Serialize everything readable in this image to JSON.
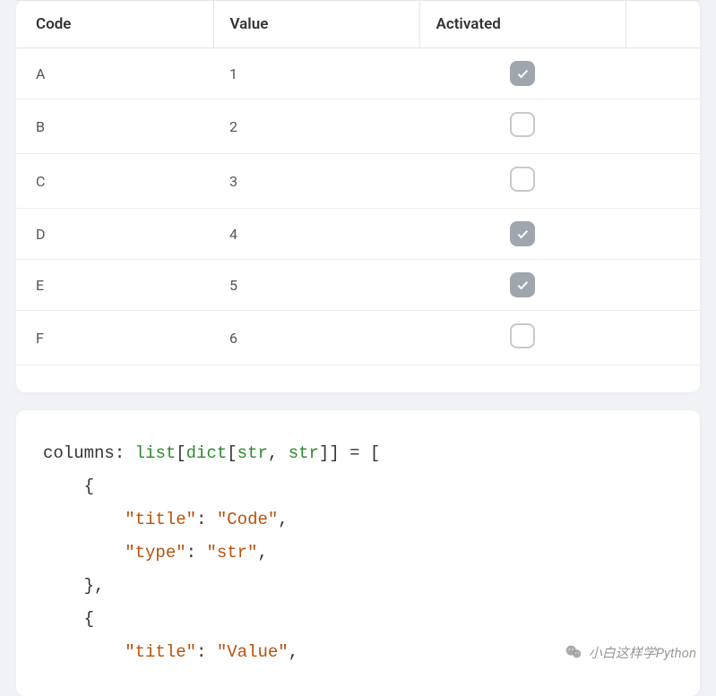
{
  "table": {
    "headers": {
      "code": "Code",
      "value": "Value",
      "activated": "Activated"
    },
    "rows": [
      {
        "code": "A",
        "value": "1",
        "activated": true
      },
      {
        "code": "B",
        "value": "2",
        "activated": false
      },
      {
        "code": "C",
        "value": "3",
        "activated": false
      },
      {
        "code": "D",
        "value": "4",
        "activated": true
      },
      {
        "code": "E",
        "value": "5",
        "activated": true
      },
      {
        "code": "F",
        "value": "6",
        "activated": false
      }
    ]
  },
  "code": {
    "line1_id": "columns",
    "line1_colon": ": ",
    "line1_list": "list",
    "line1_b1": "[",
    "line1_dict": "dict",
    "line1_b2": "[",
    "line1_str1": "str",
    "line1_comma": ", ",
    "line1_str2": "str",
    "line1_b3": "]] = [",
    "line2_brace": "{",
    "line3_key": "\"title\"",
    "line3_colon": ": ",
    "line3_val": "\"Code\"",
    "line3_comma": ",",
    "line4_key": "\"type\"",
    "line4_colon": ": ",
    "line4_val": "\"str\"",
    "line4_comma": ",",
    "line5_close": "},",
    "line6_brace": "{",
    "line7_key": "\"title\"",
    "line7_colon": ": ",
    "line7_val": "\"Value\"",
    "line7_comma": ","
  },
  "watermark": {
    "text": "小白这样学Python"
  }
}
